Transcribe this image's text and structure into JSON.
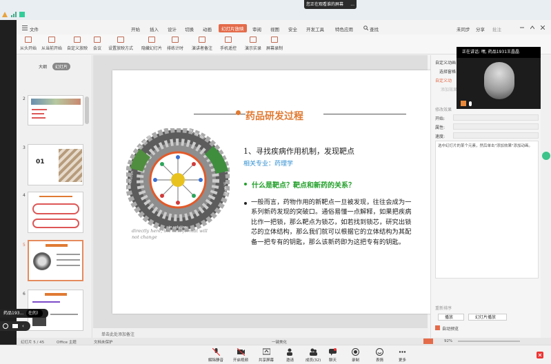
{
  "screen_share": {
    "banner": "您正在观看谁的屏幕",
    "more": "..."
  },
  "menu": {
    "file": "文件",
    "tabs": [
      "开始",
      "插入",
      "设计",
      "切换",
      "动画",
      "幻灯片放映",
      "审阅",
      "视图",
      "安全",
      "开发工具",
      "特色应用"
    ],
    "active_tab": "幻灯片放映",
    "search": "查找",
    "sync": "未同步",
    "share": "分享",
    "batch": "批注"
  },
  "ribbon": [
    "从头开始",
    "从当前开始",
    "自定义放映",
    "会议",
    "设置放映方式",
    "隐藏幻灯片",
    "排练计时",
    "演讲者备注",
    "手机遥控",
    "演示实录",
    "屏幕录制"
  ],
  "slide_panel": {
    "tabs": [
      "大纲",
      "幻灯片"
    ],
    "slides": [
      {
        "num": "2"
      },
      {
        "num": "3",
        "label": "01"
      },
      {
        "num": "4"
      },
      {
        "num": "5"
      },
      {
        "num": "6"
      }
    ]
  },
  "slide": {
    "title": "药品研发过程",
    "heading": "1、寻找疾病作用机制，发现靶点",
    "subheading": "相关专业：药理学",
    "question": "什么是靶点？靶点和新药的关系？",
    "body": "一般而言，药物作用的新靶点一旦被发现，往往会成为一系列新药发现的突破口。通俗易懂一点解释，如果把疾病比作一把锁，那么靶点为锁芯，如若找到锁芯，研究出锁芯的立体结构，那么我们就可以根据它的立体结构为其配备一把专有的钥匙，那么该新药即为这把专有的钥匙。",
    "image_caption": "directly here, the text format will not change",
    "ring_labels": [
      "in this film",
      "in solution",
      "in solution",
      "in template",
      "in solution",
      "in solution"
    ]
  },
  "notes": "单击此处添加备注",
  "status": {
    "slide_count": "幻灯片 5 / 45",
    "theme": "Office 主题",
    "doc": "文档未保护",
    "zoom": "92%",
    "beautify": "一键美化"
  },
  "right_panel": {
    "title": "自定义动画",
    "select_pane": "选择窗格",
    "custom_anim": "自定义动",
    "add_effect": "添加效果",
    "modify": "修改效果",
    "start": "开始:",
    "property": "属性:",
    "speed": "速度:",
    "hint": "选中幻灯片的某个元素，然后单击\"添加效果\"添加动画。",
    "reorder": "重新排序",
    "play": "播放",
    "slideshow": "幻灯片播放",
    "autopreview": "自动预览"
  },
  "video": {
    "speaker": "正在讲话: 嘿, 药品1931王晶晶"
  },
  "presenter": {
    "name": "药品193...",
    "badge": "在的）"
  },
  "meeting_bar": [
    "解除静音",
    "开启视频",
    "共享屏幕",
    "邀请",
    "成员(32)",
    "聊天",
    "录制",
    "表情",
    "更多"
  ],
  "colors": {
    "accent": "#e46b4a",
    "title": "#e07a32",
    "green": "#22a02a",
    "blue": "#2d8ed1"
  }
}
